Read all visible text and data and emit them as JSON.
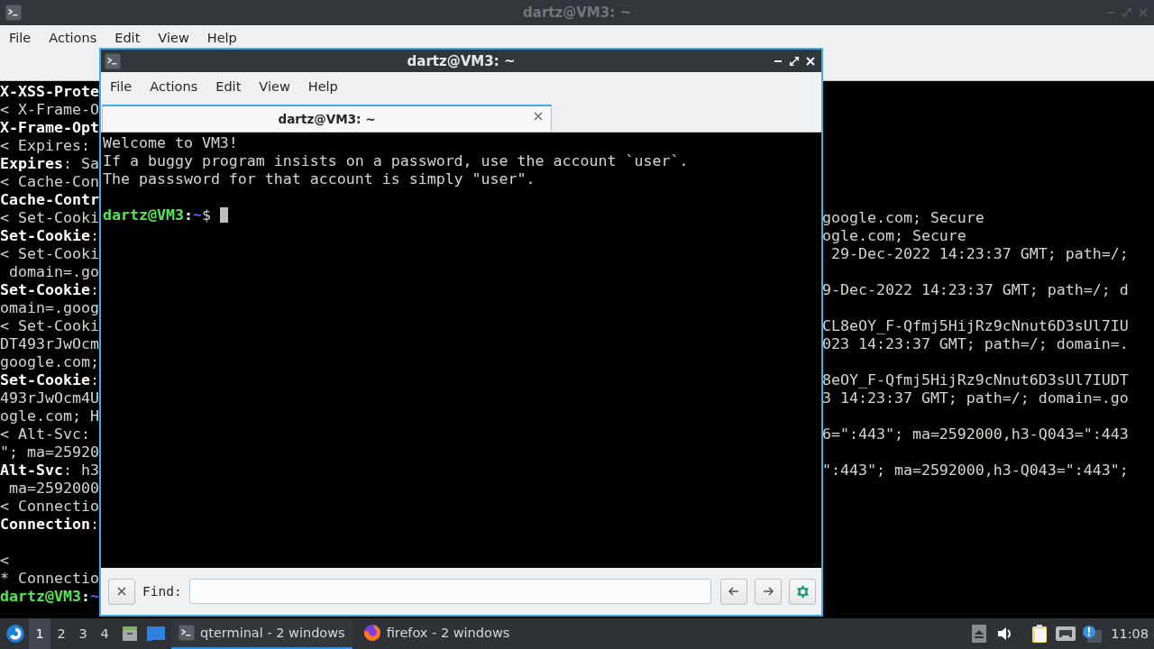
{
  "back_window": {
    "title": "dartz@VM3: ~",
    "active": false,
    "menu": [
      "File",
      "Actions",
      "Edit",
      "View",
      "Help"
    ],
    "lines": [
      {
        "left": "X-XSS-Prote",
        "bold": true
      },
      {
        "left": "< X-Frame-O",
        "bold": false
      },
      {
        "left": "X-Frame-Opt",
        "bold": true
      },
      {
        "left": "< Expires: ",
        "bold": false
      },
      {
        "left": "**Expires**: Sa",
        "bold": false
      },
      {
        "left": "< Cache-Con",
        "bold": false
      },
      {
        "left": "Cache-Contr",
        "bold": true
      },
      {
        "left": "< Set-Cooki",
        "right": "google.com; Secure",
        "bold": false
      },
      {
        "left": "**Set-Cookie**:",
        "right": "ogle.com; Secure",
        "bold": false
      },
      {
        "left": "< Set-Cooki",
        "right": " 29-Dec-2022 14:23:37 GMT; path=/;",
        "bold": false
      },
      {
        "left": " domain=.go",
        "bold": false
      },
      {
        "left": "**Set-Cookie**:",
        "right": "9-Dec-2022 14:23:37 GMT; path=/; d",
        "bold": false
      },
      {
        "left": "omain=.goog",
        "bold": false
      },
      {
        "left": "< Set-Cooki",
        "right": "CL8eOY_F-Qfmj5HijRz9cNnut6D3sUl7IU",
        "bold": false
      },
      {
        "left": "DT493rJwOcm",
        "right": "023 14:23:37 GMT; path=/; domain=.",
        "bold": false
      },
      {
        "left": "google.com;",
        "bold": false
      },
      {
        "left": "**Set-Cookie**:",
        "right": "8eOY_F-Qfmj5HijRz9cNnut6D3sUl7IUDT",
        "bold": false
      },
      {
        "left": "493rJwOcm4U",
        "right": "3 14:23:37 GMT; path=/; domain=.go",
        "bold": false
      },
      {
        "left": "ogle.com; H",
        "bold": false
      },
      {
        "left": "< Alt-Svc: ",
        "right": "6=\":443\"; ma=2592000,h3-Q043=\":443",
        "bold": false
      },
      {
        "left": "\"; ma=25920",
        "bold": false
      },
      {
        "left": "**Alt-Svc**: h3",
        "right": "\":443\"; ma=2592000,h3-Q043=\":443\";",
        "bold": false
      },
      {
        "left": " ma=2592000",
        "bold": false
      },
      {
        "left": "< Connectio",
        "bold": false
      },
      {
        "left": "**Connection**:",
        "bold": false
      },
      {
        "bold": false
      },
      {
        "left": "<",
        "bold": false
      },
      {
        "left": "* Connectio",
        "bold": false
      }
    ],
    "prompt": {
      "user": "dartz@VM3",
      "separator": ":",
      "path": "~"
    }
  },
  "front_window": {
    "title": "dartz@VM3: ~",
    "active": true,
    "menu": [
      "File",
      "Actions",
      "Edit",
      "View",
      "Help"
    ],
    "tabs": [
      {
        "label": "dartz@VM3: ~",
        "selected": true
      }
    ],
    "lines": [
      "Welcome to VM3!",
      "If a buggy program insists on a password, use the account `user`.",
      "The passsword for that account is simply \"user\"."
    ],
    "prompt": {
      "user": "dartz@VM3",
      "separator": ":",
      "path": "~",
      "symbol": "$"
    },
    "find_bar": {
      "label": "Find:"
    }
  },
  "taskbar": {
    "workspaces": [
      {
        "label": "1",
        "selected": true
      },
      {
        "label": "2",
        "selected": false
      },
      {
        "label": "3",
        "selected": false
      },
      {
        "label": "4",
        "selected": false
      }
    ],
    "tasks": [
      {
        "label": "qterminal - 2 windows",
        "kind": "terminal",
        "selected": true
      },
      {
        "label": "firefox - 2 windows",
        "kind": "browser",
        "selected": false
      }
    ],
    "clock": "11:08"
  }
}
